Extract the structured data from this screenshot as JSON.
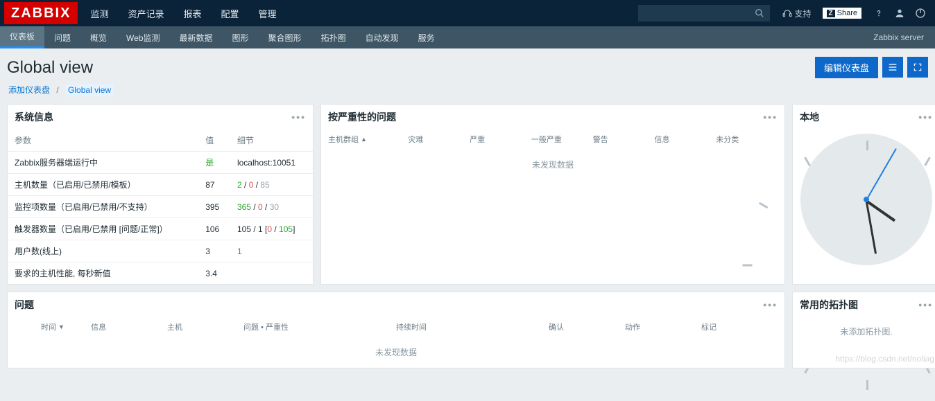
{
  "logo": "ZABBIX",
  "topnav": [
    "监测",
    "资产记录",
    "报表",
    "配置",
    "管理"
  ],
  "topnav_active": 0,
  "support_label": "支持",
  "share_label": "Share",
  "subnav": [
    "仪表板",
    "问题",
    "概览",
    "Web监测",
    "最新数据",
    "图形",
    "聚合图形",
    "拓扑图",
    "自动发现",
    "服务"
  ],
  "subnav_active": 0,
  "server_label": "Zabbix server",
  "page_title": "Global view",
  "edit_btn": "编辑仪表盘",
  "crumb_add": "添加仪表盘",
  "crumb_sep": "/",
  "crumb_current": "Global view",
  "widgets": {
    "sysinfo": {
      "title": "系统信息",
      "headers": [
        "参数",
        "值",
        "细节"
      ],
      "rows": [
        {
          "param": "Zabbix服务器端运行中",
          "value_html": "<span class='g'>是</span>",
          "detail": "localhost:10051"
        },
        {
          "param": "主机数量（已启用/已禁用/模板）",
          "value_html": "87",
          "detail": "<span class='g'>2</span> / <span class='r'>0</span> / <span class='gy'>85</span>"
        },
        {
          "param": "监控项数量（已启用/已禁用/不支持）",
          "value_html": "395",
          "detail": "<span class='g'>365</span> / <span class='r'>0</span> / <span class='gy'>30</span>"
        },
        {
          "param": "触发器数量（已启用/已禁用 [问题/正常]）",
          "value_html": "106",
          "detail": "105 / 1 [<span class='r'>0</span> / <span class='g'>105</span>]"
        },
        {
          "param": "用户数(线上)",
          "value_html": "3",
          "detail": "<span class='g'>1</span>"
        },
        {
          "param": "要求的主机性能, 每秒新值",
          "value_html": "3.4",
          "detail": ""
        }
      ]
    },
    "severity": {
      "title": "按严重性的问题",
      "cols": [
        "主机群组",
        "灾难",
        "严重",
        "一般严重",
        "警告",
        "信息",
        "未分类"
      ],
      "nodata": "未发现数据"
    },
    "clock": {
      "title": "本地"
    },
    "problems": {
      "title": "问题",
      "cols": [
        "时间",
        "信息",
        "主机",
        "问题 • 严重性",
        "",
        "持续时间",
        "",
        "确认",
        "动作",
        "标记"
      ],
      "nodata": "未发现数据"
    },
    "maps": {
      "title": "常用的拓扑图",
      "msg": "未添加拓扑图."
    }
  },
  "watermark": "https://blog.csdn.net/noliag"
}
